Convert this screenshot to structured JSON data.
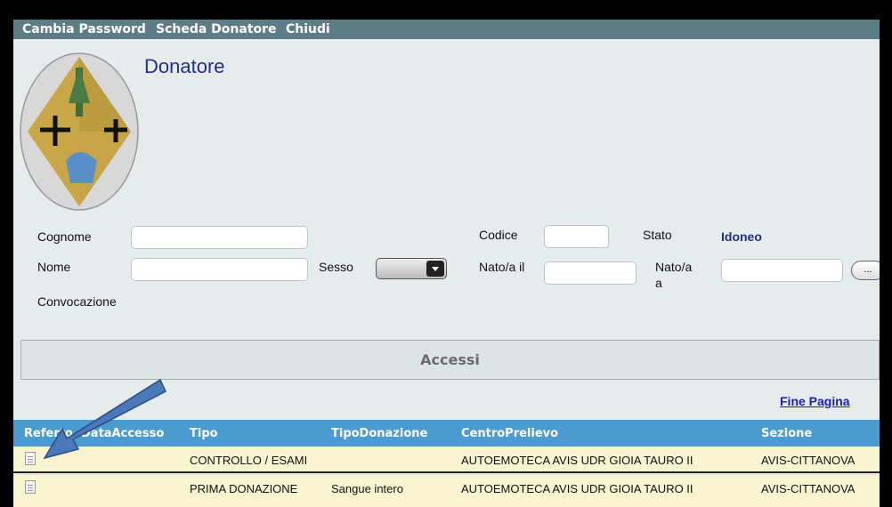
{
  "menu": {
    "items": [
      "Cambia Password",
      "Scheda Donatore",
      "Chiudi"
    ]
  },
  "page": {
    "title": "Donatore"
  },
  "form": {
    "cognome_label": "Cognome",
    "nome_label": "Nome",
    "convocazione_label": "Convocazione",
    "sesso_label": "Sesso",
    "codice_label": "Codice",
    "nato_il_label": "Nato/a il",
    "stato_label": "Stato",
    "stato_value": "Idoneo",
    "nato_a_label": "Nato/a",
    "nato_a_label_2": "a",
    "ellipsis_button": "..."
  },
  "accessi": {
    "title": "Accessi",
    "fine_pagina": "Fine Pagina"
  },
  "table": {
    "columns": [
      "Referto",
      "DataAccesso",
      "Tipo",
      "TipoDonazione",
      "CentroPrelievo",
      "Sezione"
    ],
    "rows": [
      {
        "referto_icon": "document-icon",
        "data_accesso": "",
        "tipo": "CONTROLLO / ESAMI",
        "tipo_donazione": "",
        "centro_prelievo": "AUTOEMOTECA AVIS UDR GIOIA TAURO II",
        "sezione": "AVIS-CITTANOVA"
      },
      {
        "referto_icon": "document-icon",
        "data_accesso": "",
        "tipo": "PRIMA DONAZIONE",
        "tipo_donazione": "Sangue intero",
        "centro_prelievo": "AUTOEMOTECA AVIS UDR GIOIA TAURO II",
        "sezione": "AVIS-CITTANOVA"
      }
    ]
  },
  "colors": {
    "menubar": "#5c7c86",
    "table_header": "#4a9cd0",
    "row_bg": "#f8f5d0",
    "arrow": "#4a78b8",
    "title": "#1f2f8a"
  }
}
